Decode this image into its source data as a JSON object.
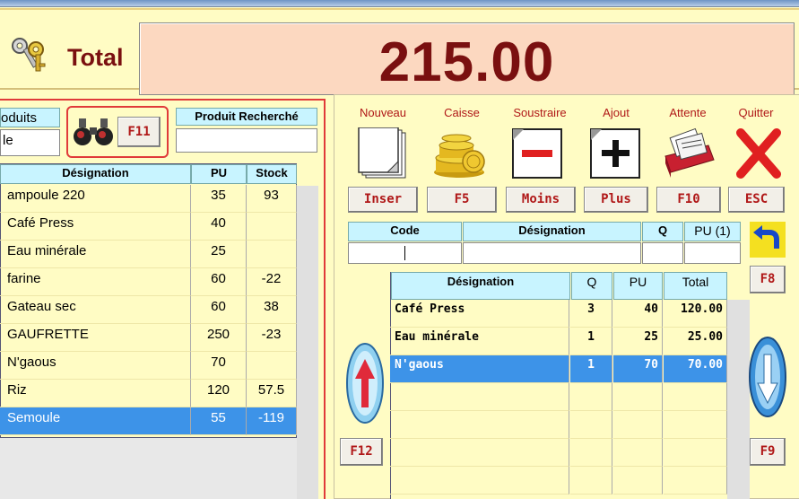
{
  "header": {
    "total_label": "Total",
    "total_value": "215.00"
  },
  "products": {
    "header_label": "oduits",
    "filter_value": "le",
    "search_button": "F11",
    "search_label": "Produit Recherché",
    "search_value": "",
    "columns": [
      "Désignation",
      "PU",
      "Stock"
    ],
    "rows": [
      {
        "name": "ampoule 220",
        "pu": "35",
        "stock": "93"
      },
      {
        "name": "Café Press",
        "pu": "40",
        "stock": ""
      },
      {
        "name": "Eau minérale",
        "pu": "25",
        "stock": ""
      },
      {
        "name": "farine",
        "pu": "60",
        "stock": "-22"
      },
      {
        "name": "Gateau sec",
        "pu": "60",
        "stock": "38"
      },
      {
        "name": "GAUFRETTE",
        "pu": "250",
        "stock": "-23"
      },
      {
        "name": "N'gaous",
        "pu": "70",
        "stock": ""
      },
      {
        "name": "Riz",
        "pu": "120",
        "stock": "57.5"
      },
      {
        "name": "Semoule",
        "pu": "55",
        "stock": "-119"
      }
    ],
    "selected_index": 8
  },
  "toolbar": {
    "items": [
      {
        "label": "Nouveau",
        "key": "Inser"
      },
      {
        "label": "Caisse",
        "key": "F5"
      },
      {
        "label": "Soustraire",
        "key": "Moins"
      },
      {
        "label": "Ajout",
        "key": "Plus"
      },
      {
        "label": "Attente",
        "key": "F10"
      },
      {
        "label": "Quitter",
        "key": "ESC"
      }
    ]
  },
  "entry": {
    "columns": [
      "Code",
      "Désignation",
      "Q",
      "PU (1)"
    ],
    "code_value": "",
    "designation_value": "",
    "q_value": "",
    "pu_value": ""
  },
  "cart": {
    "columns": [
      "Désignation",
      "Q",
      "PU",
      "Total"
    ],
    "rows": [
      {
        "name": "Café Press",
        "q": "3",
        "pu": "40",
        "total": "120.00"
      },
      {
        "name": "Eau minérale",
        "q": "1",
        "pu": "25",
        "total": "25.00"
      },
      {
        "name": "N'gaous",
        "q": "1",
        "pu": "70",
        "total": "70.00"
      }
    ],
    "selected_index": 2
  },
  "buttons": {
    "f8": "F8",
    "f9": "F9",
    "f12": "F12"
  },
  "colors": {
    "background": "#fffcc4",
    "accent_red": "#b01818",
    "header_cyan": "#c8f4ff",
    "selection": "#3d93e8",
    "total_box": "#fcd8c0"
  },
  "icons": {
    "keys": "keys-icon",
    "search": "binoculars-icon",
    "new": "new-document-icon",
    "cash": "coins-icon",
    "subtract": "minus-document-icon",
    "add": "plus-document-icon",
    "hold": "card-file-icon",
    "quit": "red-x-icon",
    "undo": "undo-arrow-icon",
    "up": "up-arrow-icon",
    "down": "down-arrow-icon"
  }
}
